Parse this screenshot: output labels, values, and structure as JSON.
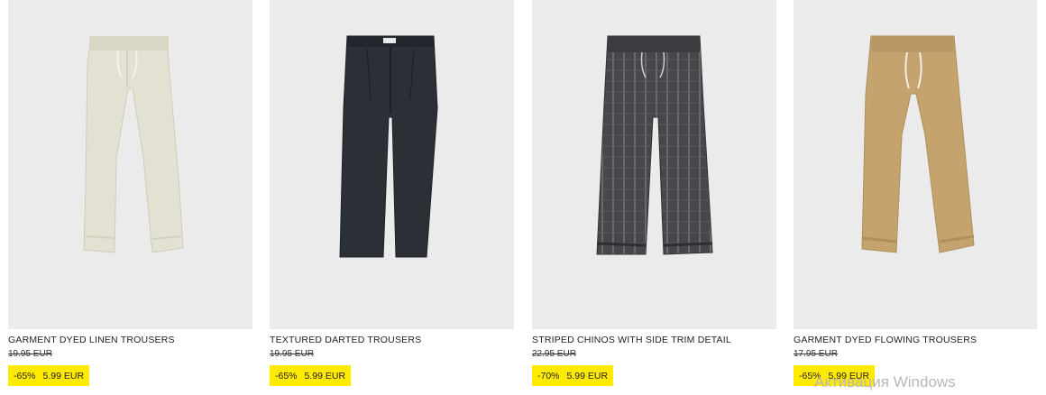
{
  "products": [
    {
      "name": "GARMENT DYED LINEN TROUSERS",
      "old_price": "19.95 EUR",
      "discount": "-65%",
      "price": "5.99 EUR",
      "color": "#e3e1d1"
    },
    {
      "name": "TEXTURED DARTED TROUSERS",
      "old_price": "19.95 EUR",
      "discount": "-65%",
      "price": "5.99 EUR",
      "color": "#2b2f36"
    },
    {
      "name": "STRIPED CHINOS WITH SIDE TRIM DETAIL",
      "old_price": "22.95 EUR",
      "discount": "-70%",
      "price": "5.99 EUR",
      "color": "#46474a"
    },
    {
      "name": "GARMENT DYED FLOWING TROUSERS",
      "old_price": "17.95 EUR",
      "discount": "-65%",
      "price": "5.99 EUR",
      "color": "#c4a36f"
    }
  ],
  "watermark": "Активация Windows",
  "colors": {
    "sale_highlight": "#ffea00",
    "photo_bg": "#ebebeb"
  }
}
